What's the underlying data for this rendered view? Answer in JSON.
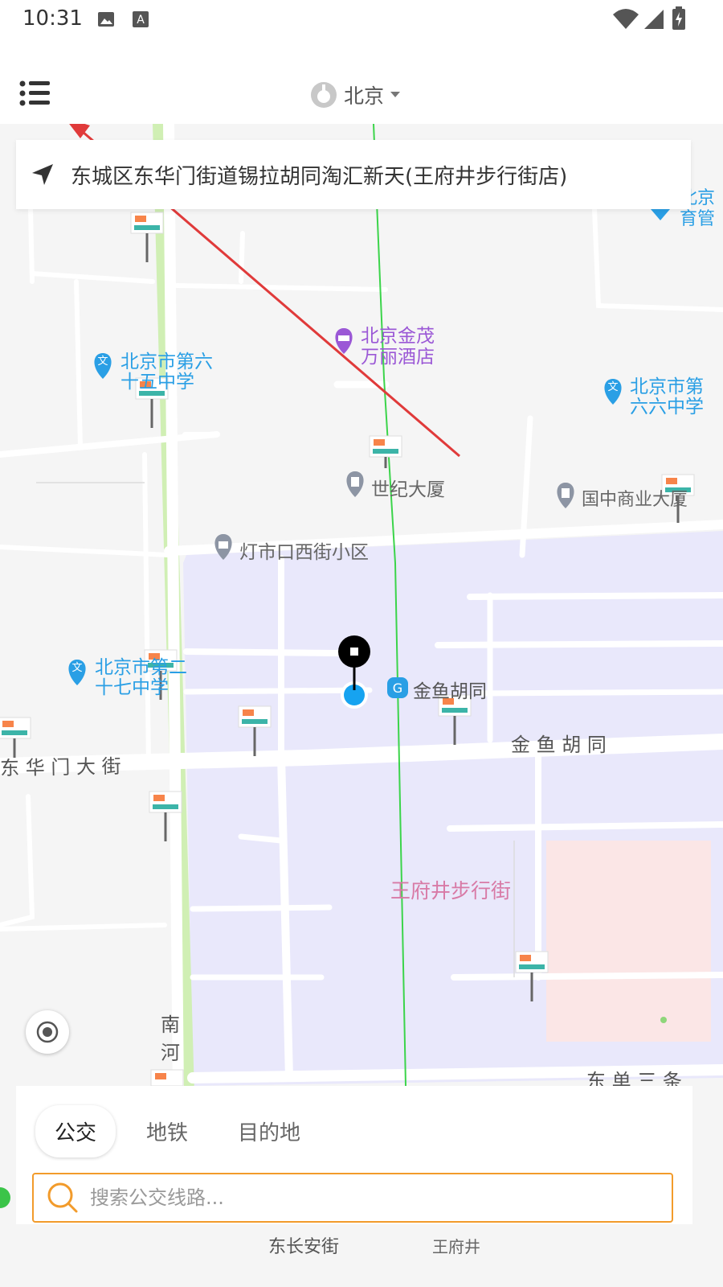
{
  "status_bar": {
    "time": "10:31"
  },
  "header": {
    "city": "北京",
    "city_icon": "city-badge-icon",
    "menu_icon": "menu-list-icon"
  },
  "current_address": {
    "text": "东城区东华门街道锡拉胡同淘汇新天(王府井步行街店)",
    "icon": "navigation-arrow-icon"
  },
  "map": {
    "labels": {
      "jinmao_hotel_1": "北京金茂",
      "jinmao_hotel_2": "万丽酒店",
      "school65_1": "北京市第六",
      "school65_2": "十五中学",
      "school66_1": "北京市第",
      "school66_2": "六六中学",
      "shiji": "世纪大厦",
      "guozhong": "国中商业大厦",
      "dengshikou": "灯市口西街小区",
      "school27_1": "北京市第二",
      "school27_2": "十七中学",
      "jinyu_station": "金鱼胡同",
      "jinyu_street": "金 鱼 胡 同",
      "donghuamen": "东 华 门 大 街",
      "wangfujing": "王府井步行街",
      "nanhe_1": "南",
      "nanhe_2": "河",
      "dongdan": "东 单 三 条",
      "edge_top_right_1": "北京",
      "edge_top_right_2": "育管",
      "bottom_changan": "东长安街",
      "bottom_wangfujing": "王府井"
    },
    "colors": {
      "residential": "#e9e8fb",
      "commercial": "#fbe6e6",
      "green": "#d0efb4",
      "road": "#ffffff",
      "accent": "#f29b2b",
      "poi_blue": "#2a9fe5",
      "poi_purple": "#9b58d6"
    }
  },
  "bottom_panel": {
    "tabs": [
      {
        "label": "公交",
        "active": true
      },
      {
        "label": "地铁",
        "active": false
      },
      {
        "label": "目的地",
        "active": false
      }
    ],
    "search": {
      "placeholder": "搜索公交线路...",
      "value": "",
      "icon": "search-icon"
    }
  },
  "locate_icon": "locate-target-icon"
}
